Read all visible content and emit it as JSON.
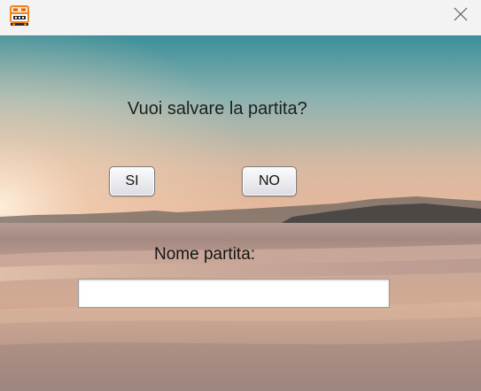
{
  "window": {
    "app_icon": "game-controller-icon",
    "close_icon": "close-icon"
  },
  "dialog": {
    "question": "Vuoi salvare la partita?",
    "yes_label": "SI",
    "no_label": "NO",
    "name_label": "Nome partita:",
    "name_value": "",
    "name_placeholder": ""
  },
  "colors": {
    "titlebar": "#f3f3f3",
    "sky_top": "#3a8f9a",
    "horizon": "#e4b69c",
    "sand": "#c5a496",
    "app_icon_orange": "#f0861f"
  }
}
